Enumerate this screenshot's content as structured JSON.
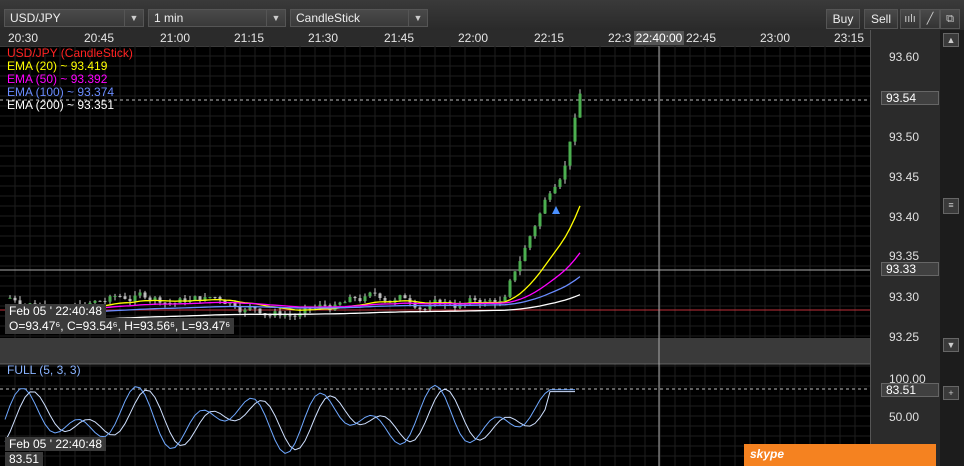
{
  "toolbar": {
    "symbol": "USD/JPY",
    "interval": "1 min",
    "chart_style": "CandleStick",
    "buy_label": "Buy",
    "sell_label": "Sell"
  },
  "time_axis": {
    "labels": [
      "20:30",
      "20:45",
      "21:00",
      "21:15",
      "21:30",
      "21:45",
      "22:00",
      "22:15",
      "22:3",
      "22:45",
      "23:00",
      "23:15"
    ],
    "crosshair_time": "22:40:00"
  },
  "price_axis": {
    "labels": [
      "93.60",
      "93.50",
      "93.45",
      "93.40",
      "93.35",
      "93.30",
      "93.25",
      "100.00",
      "50.00"
    ],
    "current_price": "93.54",
    "crosshair_price": "93.33",
    "stoch_value": "83.51"
  },
  "legend": {
    "series": "USD/JPY (CandleStick)",
    "ema20": "EMA (20) ~ 93.419",
    "ema50": "EMA (50) ~ 93.392",
    "ema100": "EMA (100) ~ 93.374",
    "ema200": "EMA (200) ~ 93.351"
  },
  "info_box": {
    "date": "Feb 05 ' 22:40:48",
    "ohlc": "O=93.47⁶, C=93.54⁶, H=93.56⁶, L=93.47⁶"
  },
  "stoch": {
    "label": "FULL (5, 3, 3)",
    "date": "Feb 05 ' 22:40:48",
    "value": "83.51"
  },
  "skype_label": "skype",
  "colors": {
    "ema20": "#ffff00",
    "ema50": "#ff00ff",
    "ema100": "#6a8cff",
    "ema200": "#ffffff",
    "series_label": "#ff2222",
    "candle_up": "#4caf50",
    "stoch_k": "#6fa8ff",
    "stoch_d": "#cfe0ff"
  }
}
